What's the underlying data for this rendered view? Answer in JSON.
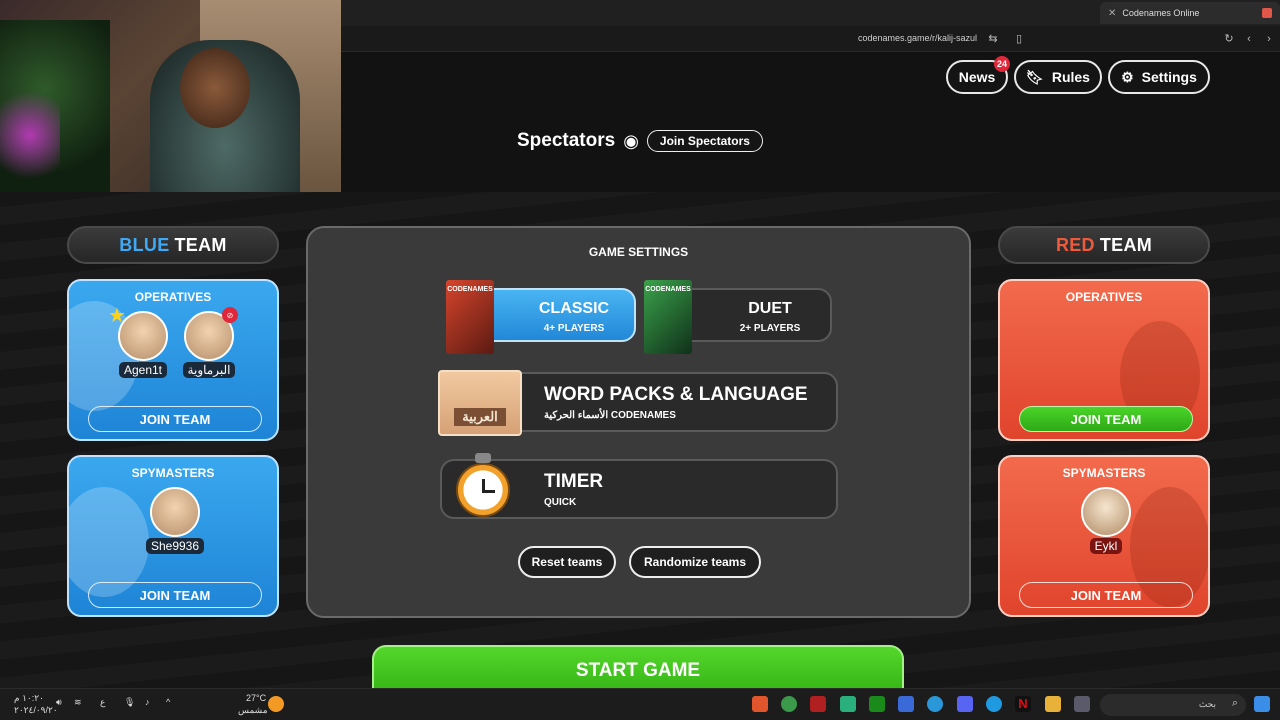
{
  "browser": {
    "tab_title": "Codenames Online",
    "url": "codenames.game/r/kalij-sazul"
  },
  "header": {
    "news_label": "News",
    "news_badge": "24",
    "rules_label": "Rules",
    "settings_label": "Settings"
  },
  "spectators": {
    "title": "Spectators",
    "join_label": "Join Spectators"
  },
  "blue_team": {
    "name_color": "BLUE",
    "name_rest": "TEAM",
    "operatives": {
      "title": "OPERATIVES",
      "players": [
        "Agen1t",
        "البرماوية"
      ],
      "join_label": "JOIN TEAM"
    },
    "spymasters": {
      "title": "SPYMASTERS",
      "players": [
        "She9936"
      ],
      "join_label": "JOIN TEAM"
    }
  },
  "red_team": {
    "name_color": "RED",
    "name_rest": "TEAM",
    "operatives": {
      "title": "OPERATIVES",
      "join_label": "JOIN TEAM"
    },
    "spymasters": {
      "title": "SPYMASTERS",
      "players": [
        "Eykl"
      ],
      "join_label": "JOIN TEAM"
    }
  },
  "game_settings": {
    "title": "GAME SETTINGS",
    "classic": {
      "label": "CLASSIC",
      "sub": "4+ PLAYERS",
      "box_text": "CODENAMES"
    },
    "duet": {
      "label": "DUET",
      "sub": "2+ PLAYERS",
      "box_text": "CODENAMES"
    },
    "word_packs": {
      "label": "WORD PACKS & LANGUAGE",
      "sub": "الأسماء الحركية CODENAMES",
      "lang": "العربية"
    },
    "timer": {
      "label": "TIMER",
      "sub": "QUICK"
    },
    "reset_label": "Reset teams",
    "randomize_label": "Randomize teams"
  },
  "start_label": "START GAME",
  "taskbar": {
    "clock_time": "١٠:٢٠ م",
    "clock_date": "٢٠٢٤/٠٩/٢٠",
    "lang": "ع",
    "weather_temp": "27°C",
    "weather_text": "مشمس",
    "search_text": "بحث"
  },
  "colors": {
    "blue_accent": "#3fa9f5",
    "red_accent": "#ef5a3c",
    "start_green": "#3fc41d"
  }
}
